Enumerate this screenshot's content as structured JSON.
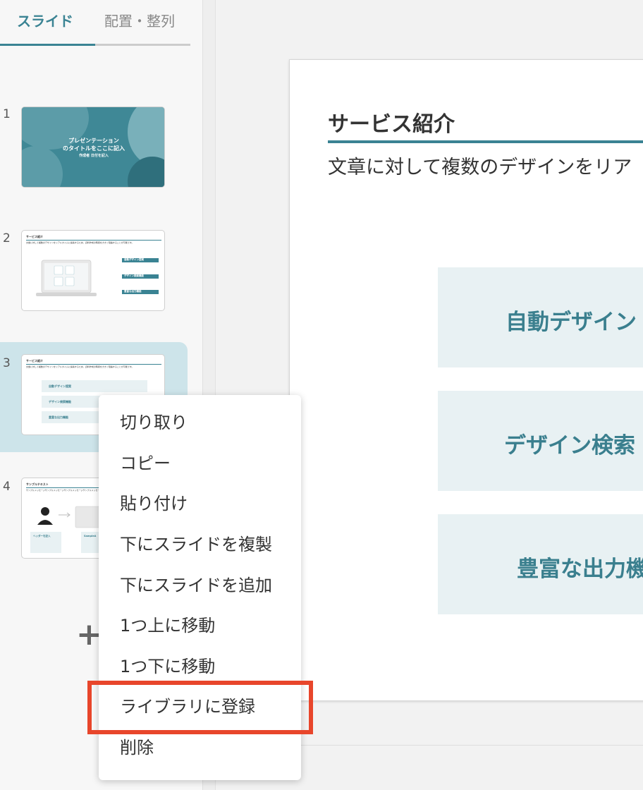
{
  "tabs": {
    "slides": "スライド",
    "arrange": "配置・整列"
  },
  "slides": [
    {
      "num": "1",
      "title": "プレゼンテーション",
      "title2": "のタイトルをここに記入",
      "author": "作成者 日付を記入"
    },
    {
      "num": "2",
      "title": "サービス紹介",
      "sub": "文章に対して複数のデザインをリアルタイムに提案するため、資料作成の時間を大きく短縮することが可能です。",
      "items": [
        "自動デザイン提案",
        "デザイン検索機能",
        "豊富な出力機能"
      ]
    },
    {
      "num": "3",
      "title": "サービス紹介",
      "sub": "文章に対して複数のデザインをリアルタイムに提案するため、資料作成の時間を大きく短縮することが可能です。",
      "items": [
        "自動デザイン提案",
        "デザイン検索機能",
        "豊富な出力機能"
      ]
    },
    {
      "num": "4",
      "title": "サンプルテキスト",
      "sub": "サンプルメッセージサンプルメッセージサンプルメッセージサンプルメッセージ",
      "label1": "ヘッダーを記入",
      "label2": "SampleA"
    }
  ],
  "add_slide": "+",
  "canvas": {
    "title": "サービス紹介",
    "subtitle": "文章に対して複数のデザインをリア",
    "features": [
      "自動デザイン",
      "デザイン検索",
      "豊富な出力機"
    ]
  },
  "context_menu": [
    "切り取り",
    "コピー",
    "貼り付け",
    "下にスライドを複製",
    "下にスライドを追加",
    "1つ上に移動",
    "1つ下に移動",
    "ライブラリに登録",
    "削除"
  ],
  "colors": {
    "accent": "#3a8393",
    "highlight": "#e8462b",
    "feature_bg": "#e8f1f3"
  }
}
